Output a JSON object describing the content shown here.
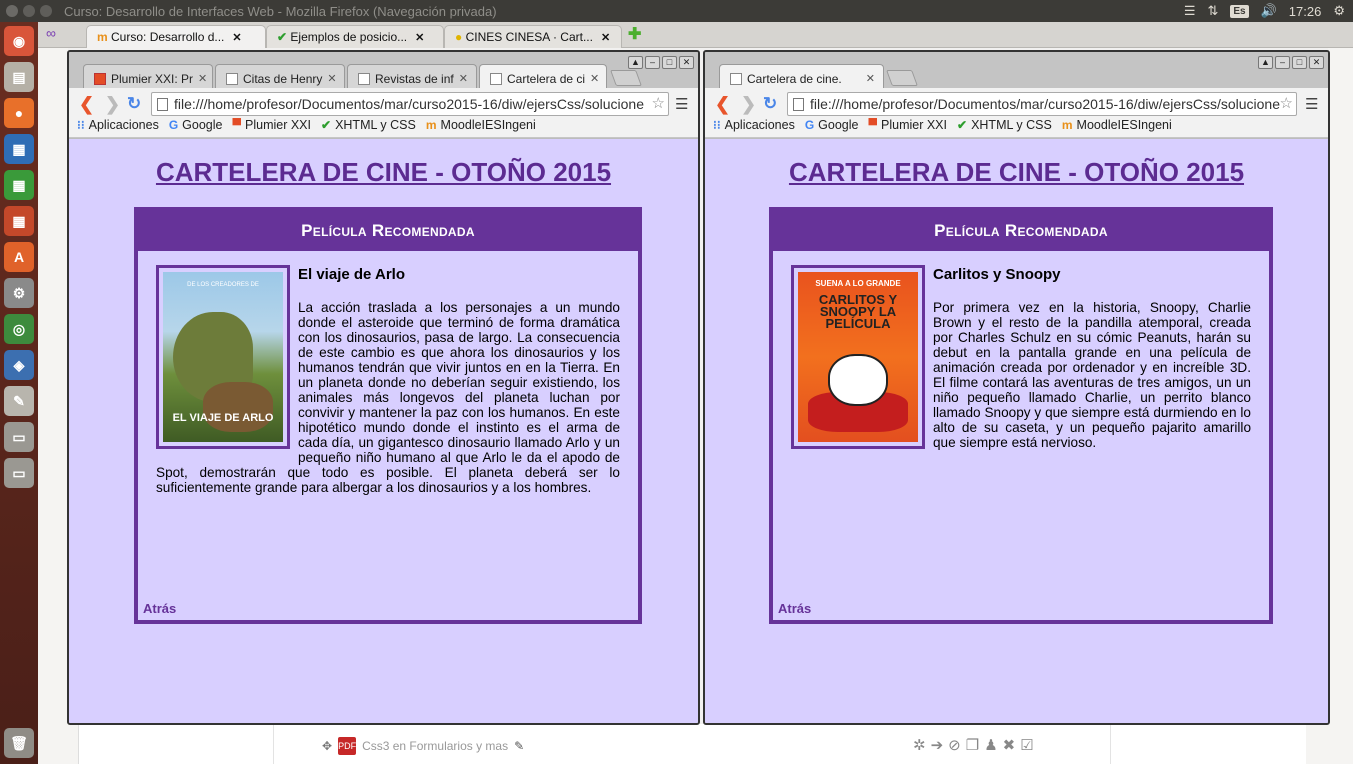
{
  "os": {
    "window_title": "Curso: Desarrollo de Interfaces Web - Mozilla Firefox (Navegación privada)",
    "keyboard_layout": "Es",
    "clock": "17:26"
  },
  "firefox": {
    "tabs": [
      {
        "label": "Curso: Desarrollo d...",
        "active": true
      },
      {
        "label": "Ejemplos de posicio...",
        "active": false
      },
      {
        "label": "CINES CINESA · Cart...",
        "active": false
      }
    ],
    "moodle_item": "Css3 en Formularios y mas"
  },
  "left_window": {
    "tabs": [
      {
        "label": "Plumier XXI: Pr"
      },
      {
        "label": "Citas de Henry"
      },
      {
        "label": "Revistas de inf"
      },
      {
        "label": "Cartelera de ci"
      }
    ],
    "url": "file:///home/profesor/Documentos/mar/curso2015-16/diw/ejersCss/solucione",
    "bookmarks": [
      "Aplicaciones",
      "Google",
      "Plumier XXI",
      "XHTML y CSS",
      "MoodleIESIngeni"
    ],
    "page": {
      "heading": "CARTELERA DE CINE - OTOÑO 2015",
      "box_title": "Película Recomendada",
      "film_title": "El viaje de Arlo",
      "poster_top": "DE LOS CREADORES DE",
      "poster_title": "EL VIAJE DE ARLO",
      "synopsis": "La acción traslada a los personajes a un mundo donde el asteroide que terminó de forma dramática con los dinosaurios, pasa de largo. La consecuencia de este cambio es que ahora los dinosaurios y los humanos tendrán que vivir juntos en en la Tierra. En un planeta donde no deberían seguir existiendo, los animales más longevos del planeta luchan por convivir y mantener la paz con los humanos. En este hipotético mundo donde el instinto es el arma de cada día, un gigantesco dinosaurio llamado Arlo y un pequeño niño humano al que Arlo le da el apodo de Spot, demostrarán que todo es posible. El planeta deberá ser lo suficientemente grande para albergar a los dinosaurios y a los hombres.",
      "back_link": "Atrás"
    }
  },
  "right_window": {
    "tabs": [
      {
        "label": "Cartelera de cine."
      }
    ],
    "url": "file:///home/profesor/Documentos/mar/curso2015-16/diw/ejersCss/solucione",
    "bookmarks": [
      "Aplicaciones",
      "Google",
      "Plumier XXI",
      "XHTML y CSS",
      "MoodleIESIngeni"
    ],
    "page": {
      "heading": "CARTELERA DE CINE - OTOÑO 2015",
      "box_title": "Película Recomendada",
      "film_title": "Carlitos y Snoopy",
      "poster_banner": "SUENA A LO GRANDE",
      "poster_title": "CARLITOS Y SNOOPY LA PELÍCULA",
      "synopsis": "Por primera vez en la historia, Snoopy, Charlie Brown y el resto de la pandilla atemporal, creada por Charles Schulz en su cómic Peanuts, harán su debut en la pantalla grande en una película de animación creada por ordenador y en increíble 3D. El filme contará las aventuras de tres amigos, un un niño pequeño llamado Charlie, un perrito blanco llamado Snoopy y que siempre está durmiendo en lo alto de su caseta, y un pequeño pajarito amarillo que siempre está nervioso.",
      "back_link": "Atrás"
    }
  },
  "colors": {
    "accent": "#663399",
    "page_background": "#d8cfff"
  }
}
